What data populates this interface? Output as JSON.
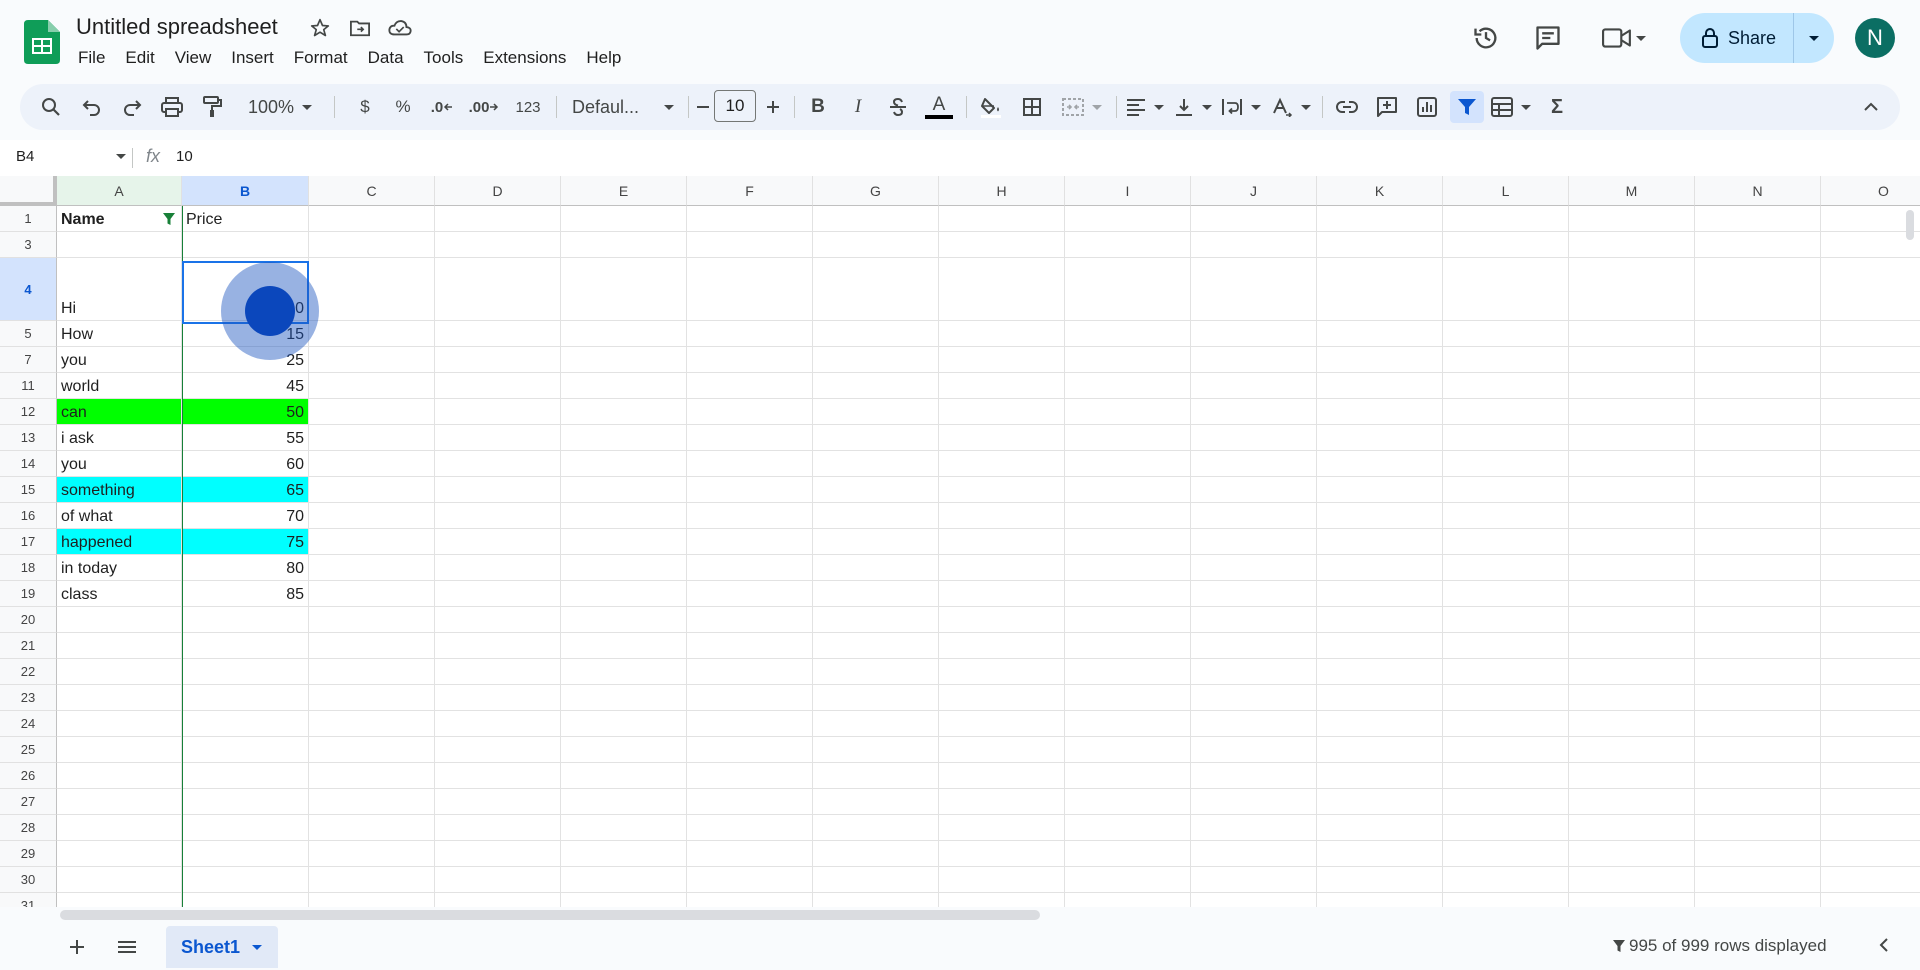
{
  "header": {
    "doc_title": "Untitled spreadsheet",
    "menu": [
      "File",
      "Edit",
      "View",
      "Insert",
      "Format",
      "Data",
      "Tools",
      "Extensions",
      "Help"
    ],
    "share_label": "Share",
    "avatar_letter": "N"
  },
  "toolbar": {
    "zoom": "100%",
    "currency": "$",
    "percent": "%",
    "decrease_decimal": ".0",
    "increase_decimal": ".00",
    "more_formats": "123",
    "font": "Defaul...",
    "font_size": "10",
    "bold": "B",
    "italic": "I",
    "text_color": "A",
    "functions": "Σ"
  },
  "formula_bar": {
    "cell_ref": "B4",
    "fx": "fx",
    "value": "10"
  },
  "columns": [
    "A",
    "B",
    "C",
    "D",
    "E",
    "F",
    "G",
    "H",
    "I",
    "J",
    "K",
    "L",
    "M",
    "N",
    "O"
  ],
  "rows": [
    {
      "num": "1",
      "a": "Name",
      "b": "Price"
    },
    {
      "num": "3",
      "a": "",
      "b": ""
    },
    {
      "num": "4",
      "a": "Hi",
      "b": "10"
    },
    {
      "num": "5",
      "a": "How",
      "b": "15"
    },
    {
      "num": "7",
      "a": "you",
      "b": "25"
    },
    {
      "num": "11",
      "a": "world",
      "b": "45"
    },
    {
      "num": "12",
      "a": "can",
      "b": "50",
      "fill": "#00ff00"
    },
    {
      "num": "13",
      "a": "i ask",
      "b": "55"
    },
    {
      "num": "14",
      "a": "you",
      "b": "60"
    },
    {
      "num": "15",
      "a": "something",
      "b": "65",
      "fill": "#00ffff"
    },
    {
      "num": "16",
      "a": "of what",
      "b": "70"
    },
    {
      "num": "17",
      "a": "happened",
      "b": "75",
      "fill": "#00ffff"
    },
    {
      "num": "18",
      "a": "in today",
      "b": "80"
    },
    {
      "num": "19",
      "a": "class",
      "b": "85"
    },
    {
      "num": "20",
      "a": "",
      "b": ""
    },
    {
      "num": "21",
      "a": "",
      "b": ""
    },
    {
      "num": "22",
      "a": "",
      "b": ""
    },
    {
      "num": "23",
      "a": "",
      "b": ""
    },
    {
      "num": "24",
      "a": "",
      "b": ""
    },
    {
      "num": "25",
      "a": "",
      "b": ""
    },
    {
      "num": "26",
      "a": "",
      "b": ""
    },
    {
      "num": "27",
      "a": "",
      "b": ""
    },
    {
      "num": "28",
      "a": "",
      "b": ""
    },
    {
      "num": "29",
      "a": "",
      "b": ""
    },
    {
      "num": "30",
      "a": "",
      "b": ""
    },
    {
      "num": "31",
      "a": "",
      "b": ""
    }
  ],
  "bottom": {
    "sheet_name": "Sheet1",
    "rows_displayed": "995 of 999 rows displayed"
  },
  "colors": {
    "accent": "#0b57d0",
    "share_bg": "#c2e7ff",
    "avatar_bg": "#0b6e63",
    "green_fill": "#00ff00",
    "cyan_fill": "#00ffff",
    "filter_green": "#188038"
  }
}
